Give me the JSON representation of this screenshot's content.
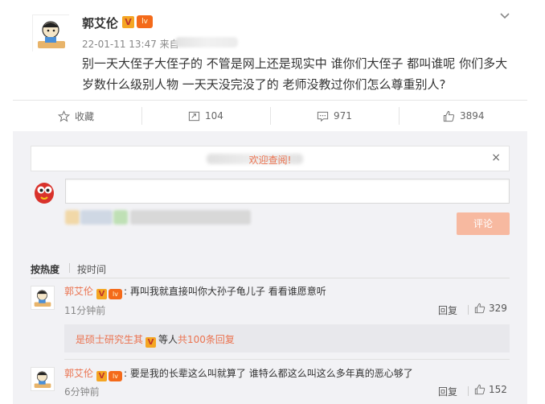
{
  "post": {
    "author": "郭艾伦",
    "verified_badge": "V",
    "level_badge": "lv",
    "timestamp": "22-01-11 13:47 来自",
    "text": "别一天大侄子大侄子的 不管是网上还是现实中 谁你们大侄子 都叫谁呢 你们多大岁数什么级别人物 一天天没完没了的 老师没教过你们怎么尊重别人?"
  },
  "actions": {
    "favorite": "收藏",
    "repost_count": "104",
    "comment_count": "971",
    "like_count": "3894"
  },
  "welcome": {
    "text": "欢迎查阅!",
    "close": "×"
  },
  "composer": {
    "placeholder": "",
    "submit_label": "评论"
  },
  "sort": {
    "hot": "按热度",
    "time": "按时间"
  },
  "comments": [
    {
      "author": "郭艾伦",
      "text": ": 再叫我就直接叫你大孙子龟儿子 看看谁愿意听",
      "time": "11分钟前",
      "reply_label": "回复",
      "likes": "329"
    },
    {
      "author": "郭艾伦",
      "text": ": 要是我的长辈这么叫就算了 谁特么都这么叫这么多年真的恶心够了",
      "time": "6分钟前",
      "reply_label": "回复",
      "likes": "152"
    }
  ],
  "sub_reply": {
    "author": "是硕士研究生其",
    "verified_badge": "V",
    "text_etc": "等人",
    "total": "共100条回复"
  },
  "colors": {
    "accent": "#eb7350",
    "badge_gold": "#f5a623",
    "submit_disabled": "#f7b9a0",
    "comment_bg": "#f2f2f5"
  },
  "icons": [
    "chevron-down-icon",
    "star-icon",
    "repost-icon",
    "comment-icon",
    "thumbs-up-icon",
    "close-icon"
  ]
}
